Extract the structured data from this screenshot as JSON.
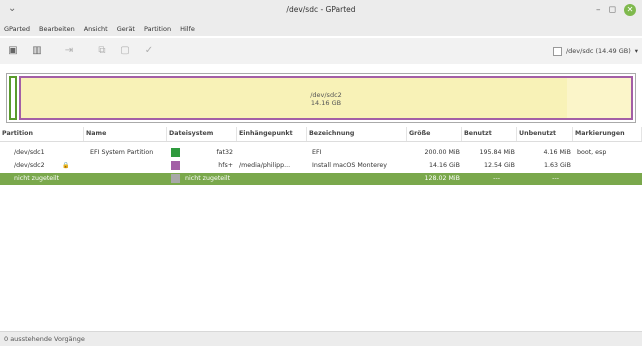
{
  "window": {
    "title": "/dev/sdc - GParted",
    "menu_icon": "⌄",
    "minimize": "–",
    "maximize": "◻",
    "close": "✕"
  },
  "menu": [
    "GParted",
    "Bearbeiten",
    "Ansicht",
    "Gerät",
    "Partition",
    "Hilfe"
  ],
  "toolbar": {
    "buttons": [
      {
        "icon": "new-partition-icon",
        "glyph": "▣"
      },
      {
        "icon": "delete-icon",
        "glyph": "▥"
      },
      {
        "icon": "resize-move-icon",
        "glyph": "⇥"
      },
      {
        "icon": "copy-icon",
        "glyph": "⧉"
      },
      {
        "icon": "paste-icon",
        "glyph": "▢"
      },
      {
        "icon": "apply-icon",
        "glyph": "✓"
      }
    ],
    "device": "/dev/sdc (14.49 GB)",
    "device_arrow": "▾"
  },
  "diskmap": {
    "partition2_name": "/dev/sdc2",
    "partition2_size": "14.16 GB",
    "used_fraction": 0.895
  },
  "table": {
    "headers": [
      "Partition",
      "Name",
      "Dateisystem",
      "Einhängepunkt",
      "Bezeichnung",
      "Größe",
      "Benutzt",
      "Unbenutzt",
      "Markierungen"
    ],
    "rows": [
      {
        "partition": "/dev/sdc1",
        "name": "EFI System Partition",
        "fs": "fat32",
        "mount": "",
        "label": "EFI",
        "size": "200.00 MiB",
        "used": "195.84 MiB",
        "unused": "4.16 MiB",
        "flags": "boot, esp",
        "color": "#2f9a3e"
      },
      {
        "partition": "/dev/sdc2",
        "name": "",
        "fs": "hfs+",
        "mount": "/media/philipp...",
        "label": "Install macOS Monterey",
        "size": "14.16 GiB",
        "used": "12.54 GiB",
        "unused": "1.63 GiB",
        "flags": "",
        "color": "#a35fa6",
        "lock_icon": "🔒"
      },
      {
        "partition": "nicht zugeteilt",
        "name": "",
        "fs": "nicht zugeteilt",
        "mount": "",
        "label": "",
        "size": "128.02 MiB",
        "used": "---",
        "unused": "---",
        "flags": "",
        "color": "#a8a8a8"
      }
    ]
  },
  "statusbar": {
    "text": "0 ausstehende Vorgänge"
  },
  "colors": {
    "accent_selection": "#7aa84c",
    "fat32": "#2f9a3e",
    "hfsplus": "#a35fa6",
    "unallocated": "#a8a8a8"
  }
}
